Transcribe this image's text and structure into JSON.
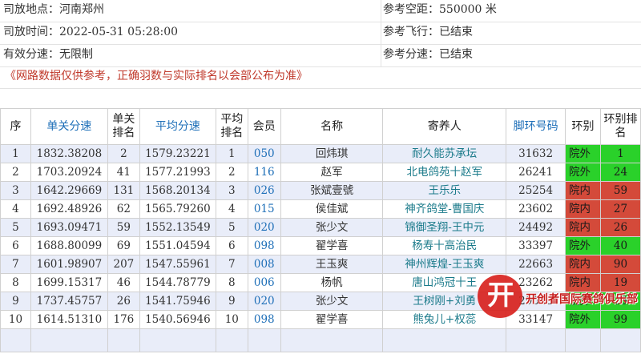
{
  "info": {
    "place_label": "司放地点：",
    "place_value": "河南郑州",
    "time_label": "司放时间：",
    "time_value": "2022-05-31 05:28:00",
    "speed_label": "有效分速：",
    "speed_value": "无限制",
    "distance_label": "参考空距：",
    "distance_value": "550000 米",
    "flight_label": "参考飞行：",
    "flight_value": "已结束",
    "refspeed_label": "参考分速：",
    "refspeed_value": "已结束"
  },
  "notice": "《网路数据仅供参考，正确羽数与实际排名以会部公布为准》",
  "table": {
    "headers": [
      "序",
      "单关分速",
      "单关排名",
      "平均分速",
      "平均排名",
      "会员",
      "名称",
      "寄养人",
      "脚环号码",
      "环别",
      "环别排名"
    ],
    "rows": [
      {
        "no": "1",
        "speed": "1832.38208",
        "rank": "2",
        "avg": "1579.23221",
        "avgrank": "1",
        "member": "050",
        "name": "回炜琪",
        "owner": "耐久能苏承坛",
        "ring": "31632",
        "type": "院外",
        "typerank": "1",
        "kind": "out"
      },
      {
        "no": "2",
        "speed": "1703.20924",
        "rank": "41",
        "avg": "1577.21993",
        "avgrank": "2",
        "member": "116",
        "name": "赵军",
        "owner": "北电鸽苑十赵军",
        "ring": "26241",
        "type": "院外",
        "typerank": "24",
        "kind": "out"
      },
      {
        "no": "3",
        "speed": "1642.29669",
        "rank": "131",
        "avg": "1568.20134",
        "avgrank": "3",
        "member": "026",
        "name": "张斌壹號",
        "owner": "王乐乐",
        "ring": "25254",
        "type": "院内",
        "typerank": "59",
        "kind": "in"
      },
      {
        "no": "4",
        "speed": "1692.48926",
        "rank": "62",
        "avg": "1565.79260",
        "avgrank": "4",
        "member": "015",
        "name": "侯佳斌",
        "owner": "神齐鸽堂-曹国庆",
        "ring": "23602",
        "type": "院内",
        "typerank": "27",
        "kind": "in"
      },
      {
        "no": "5",
        "speed": "1693.09471",
        "rank": "59",
        "avg": "1552.13549",
        "avgrank": "5",
        "member": "020",
        "name": "张少文",
        "owner": "锦御圣翔-王中元",
        "ring": "24492",
        "type": "院内",
        "typerank": "26",
        "kind": "in"
      },
      {
        "no": "6",
        "speed": "1688.80099",
        "rank": "69",
        "avg": "1551.04594",
        "avgrank": "6",
        "member": "098",
        "name": "翟学喜",
        "owner": "杨寿十高治民",
        "ring": "33397",
        "type": "院外",
        "typerank": "40",
        "kind": "out"
      },
      {
        "no": "7",
        "speed": "1601.98907",
        "rank": "207",
        "avg": "1547.55961",
        "avgrank": "7",
        "member": "008",
        "name": "王玉爽",
        "owner": "神州辉煌-王玉爽",
        "ring": "22663",
        "type": "院内",
        "typerank": "90",
        "kind": "in"
      },
      {
        "no": "8",
        "speed": "1699.15317",
        "rank": "46",
        "avg": "1544.78779",
        "avgrank": "8",
        "member": "006",
        "name": "杨帆",
        "owner": "唐山鸿冠十王",
        "ring": "23262",
        "type": "院内",
        "typerank": "19",
        "kind": "in"
      },
      {
        "no": "9",
        "speed": "1737.45757",
        "rank": "26",
        "avg": "1541.75946",
        "avgrank": "9",
        "member": "020",
        "name": "张少文",
        "owner": "王树刚+刘勇",
        "ring": "29515",
        "type": "院外",
        "typerank": "15",
        "kind": "out"
      },
      {
        "no": "10",
        "speed": "1614.51310",
        "rank": "176",
        "avg": "1540.56946",
        "avgrank": "10",
        "member": "098",
        "name": "翟学喜",
        "owner": "熊兔儿+权蕊",
        "ring": "33147",
        "type": "院外",
        "typerank": "99",
        "kind": "out"
      }
    ]
  },
  "brand": {
    "mark": "开",
    "name": "开创者国际赛鸽俱乐部"
  },
  "colors": {
    "out": "#2ad12a",
    "in": "#d44a3a",
    "link": "#1e6fb8",
    "row_alt": "#e9edf9"
  }
}
